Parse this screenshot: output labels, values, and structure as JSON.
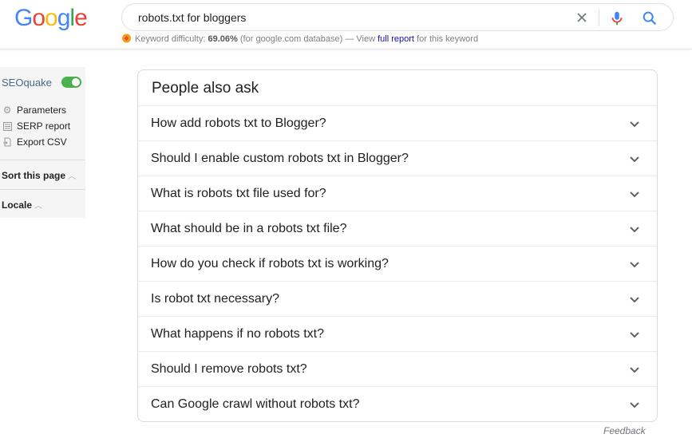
{
  "header": {
    "logo_letters": [
      {
        "ch": "G",
        "color": "#4285F4"
      },
      {
        "ch": "o",
        "color": "#EA4335"
      },
      {
        "ch": "o",
        "color": "#FBBC05"
      },
      {
        "ch": "g",
        "color": "#4285F4"
      },
      {
        "ch": "l",
        "color": "#34A853"
      },
      {
        "ch": "e",
        "color": "#EA4335"
      }
    ],
    "search_query": "robots.txt for bloggers"
  },
  "keyword_difficulty": {
    "label": "Keyword difficulty:",
    "value": "69.06%",
    "db_note": "(for google.com database) — View",
    "link_text": "full report",
    "suffix": "for this keyword"
  },
  "seoquake": {
    "title": "SEOquake",
    "menu": [
      {
        "label": "Parameters",
        "icon": "gear-icon"
      },
      {
        "label": "SERP report",
        "icon": "list-icon"
      },
      {
        "label": "Export CSV",
        "icon": "export-icon"
      }
    ],
    "sort_label": "Sort this page",
    "locale_label": "Locale"
  },
  "paa": {
    "title": "People also ask",
    "questions": [
      "How add robots txt to Blogger?",
      "Should I enable custom robots txt in Blogger?",
      "What is robots txt file used for?",
      "What should be in a robots txt file?",
      "How do you check if robots txt is working?",
      "Is robot txt necessary?",
      "What happens if no robots txt?",
      "Should I remove robots txt?",
      "Can Google crawl without robots txt?"
    ]
  },
  "feedback_label": "Feedback",
  "colors": {
    "accent_link": "#1a0dab",
    "toggle_on": "#4caf50",
    "mic_blue": "#4285F4",
    "mic_red": "#EA4335"
  }
}
